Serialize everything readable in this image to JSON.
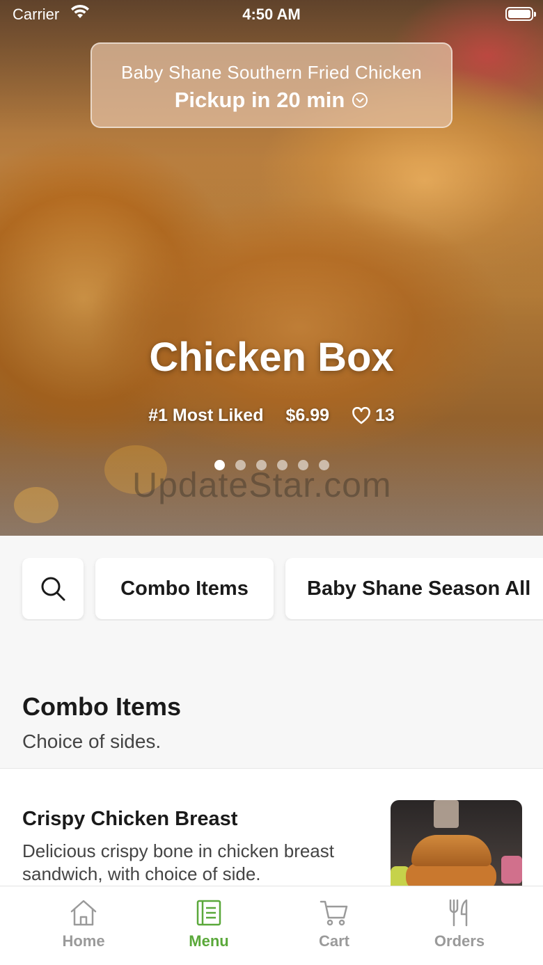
{
  "status_bar": {
    "carrier": "Carrier",
    "time": "4:50 AM"
  },
  "pickup": {
    "restaurant": "Baby Shane Southern Fried Chicken",
    "eta": "Pickup in 20 min"
  },
  "hero": {
    "title": "Chicken Box",
    "rank": "#1 Most Liked",
    "price": "$6.99",
    "likes": "13",
    "carousel": {
      "count": 6,
      "active_index": 0
    }
  },
  "watermark": "UpdateStar.com",
  "categories": [
    "Combo Items",
    "Baby Shane Season All"
  ],
  "section": {
    "title": "Combo Items",
    "subtitle": "Choice of sides."
  },
  "items": [
    {
      "name": "Crispy Chicken Breast",
      "description": "Delicious crispy bone in chicken breast sandwich, with choice of side."
    }
  ],
  "tabs": [
    {
      "label": "Home",
      "icon": "home-icon",
      "active": false
    },
    {
      "label": "Menu",
      "icon": "menu-icon",
      "active": true
    },
    {
      "label": "Cart",
      "icon": "cart-icon",
      "active": false
    },
    {
      "label": "Orders",
      "icon": "utensils-icon",
      "active": false
    }
  ],
  "colors": {
    "accent": "#5aa83a",
    "inactive": "#9a9a9a"
  }
}
